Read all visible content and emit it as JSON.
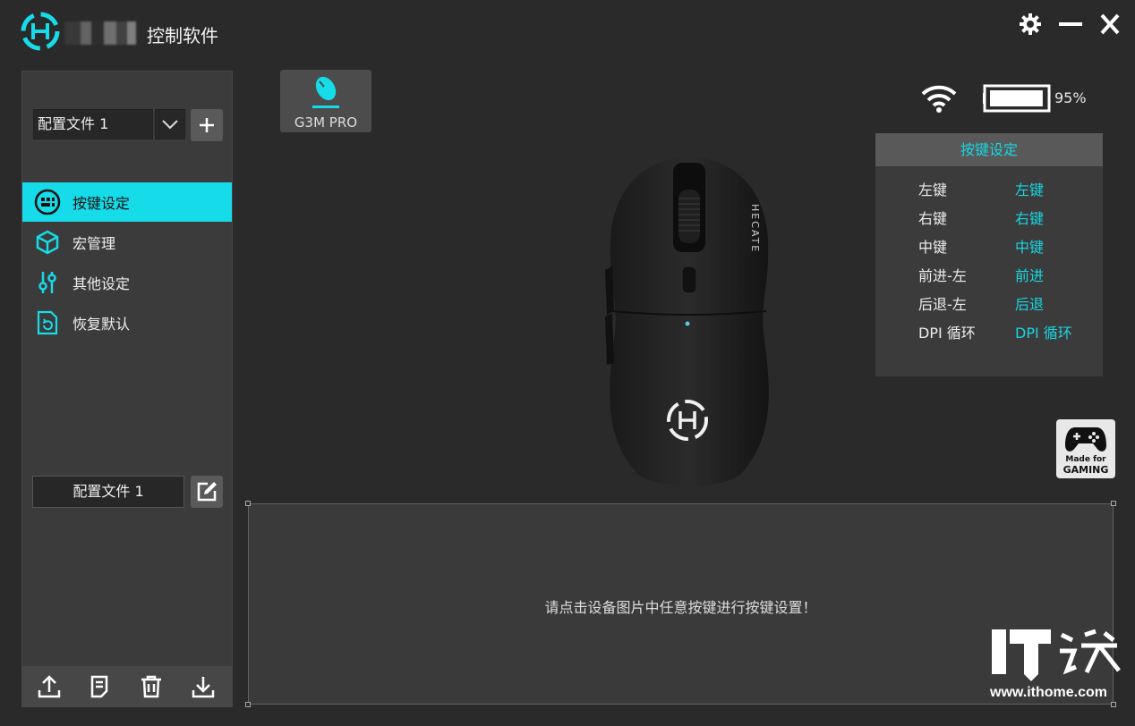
{
  "app": {
    "title": "控制软件",
    "brand_color": "#16dbe8"
  },
  "window_controls": {
    "settings_icon": "gear-icon",
    "minimize_icon": "minimize-icon",
    "close_icon": "close-icon"
  },
  "sidebar": {
    "profile_select": {
      "value": "配置文件 1"
    },
    "add_button_icon": "plus-icon",
    "nav_items": [
      {
        "label": "按键设定",
        "icon": "keypad-icon",
        "active": true
      },
      {
        "label": "宏管理",
        "icon": "cube-icon",
        "active": false
      },
      {
        "label": "其他设定",
        "icon": "sliders-icon",
        "active": false
      },
      {
        "label": "恢复默认",
        "icon": "restore-icon",
        "active": false
      }
    ],
    "profile_name": "配置文件 1",
    "footer_icons": [
      "upload-icon",
      "document-icon",
      "trash-icon",
      "download-icon"
    ]
  },
  "device": {
    "name": "G3M PRO",
    "brand_on_mouse": "HECATE"
  },
  "status": {
    "wifi_icon": "wifi-icon",
    "battery_percent": 95,
    "battery_text": "95%"
  },
  "key_panel": {
    "title": "按键设定",
    "rows": [
      {
        "key": "左键",
        "value": "左键"
      },
      {
        "key": "右键",
        "value": "右键"
      },
      {
        "key": "中键",
        "value": "中键"
      },
      {
        "key": "前进-左",
        "value": "前进"
      },
      {
        "key": "后退-左",
        "value": "后退"
      },
      {
        "key": "DPI 循环",
        "value": "DPI 循环"
      }
    ]
  },
  "badge": {
    "line1": "Made for",
    "line2": "GAMING"
  },
  "info": {
    "message": "请点击设备图片中任意按键进行按键设置！"
  },
  "watermark": {
    "logo": "IT之家",
    "url": "www.ithome.com"
  }
}
